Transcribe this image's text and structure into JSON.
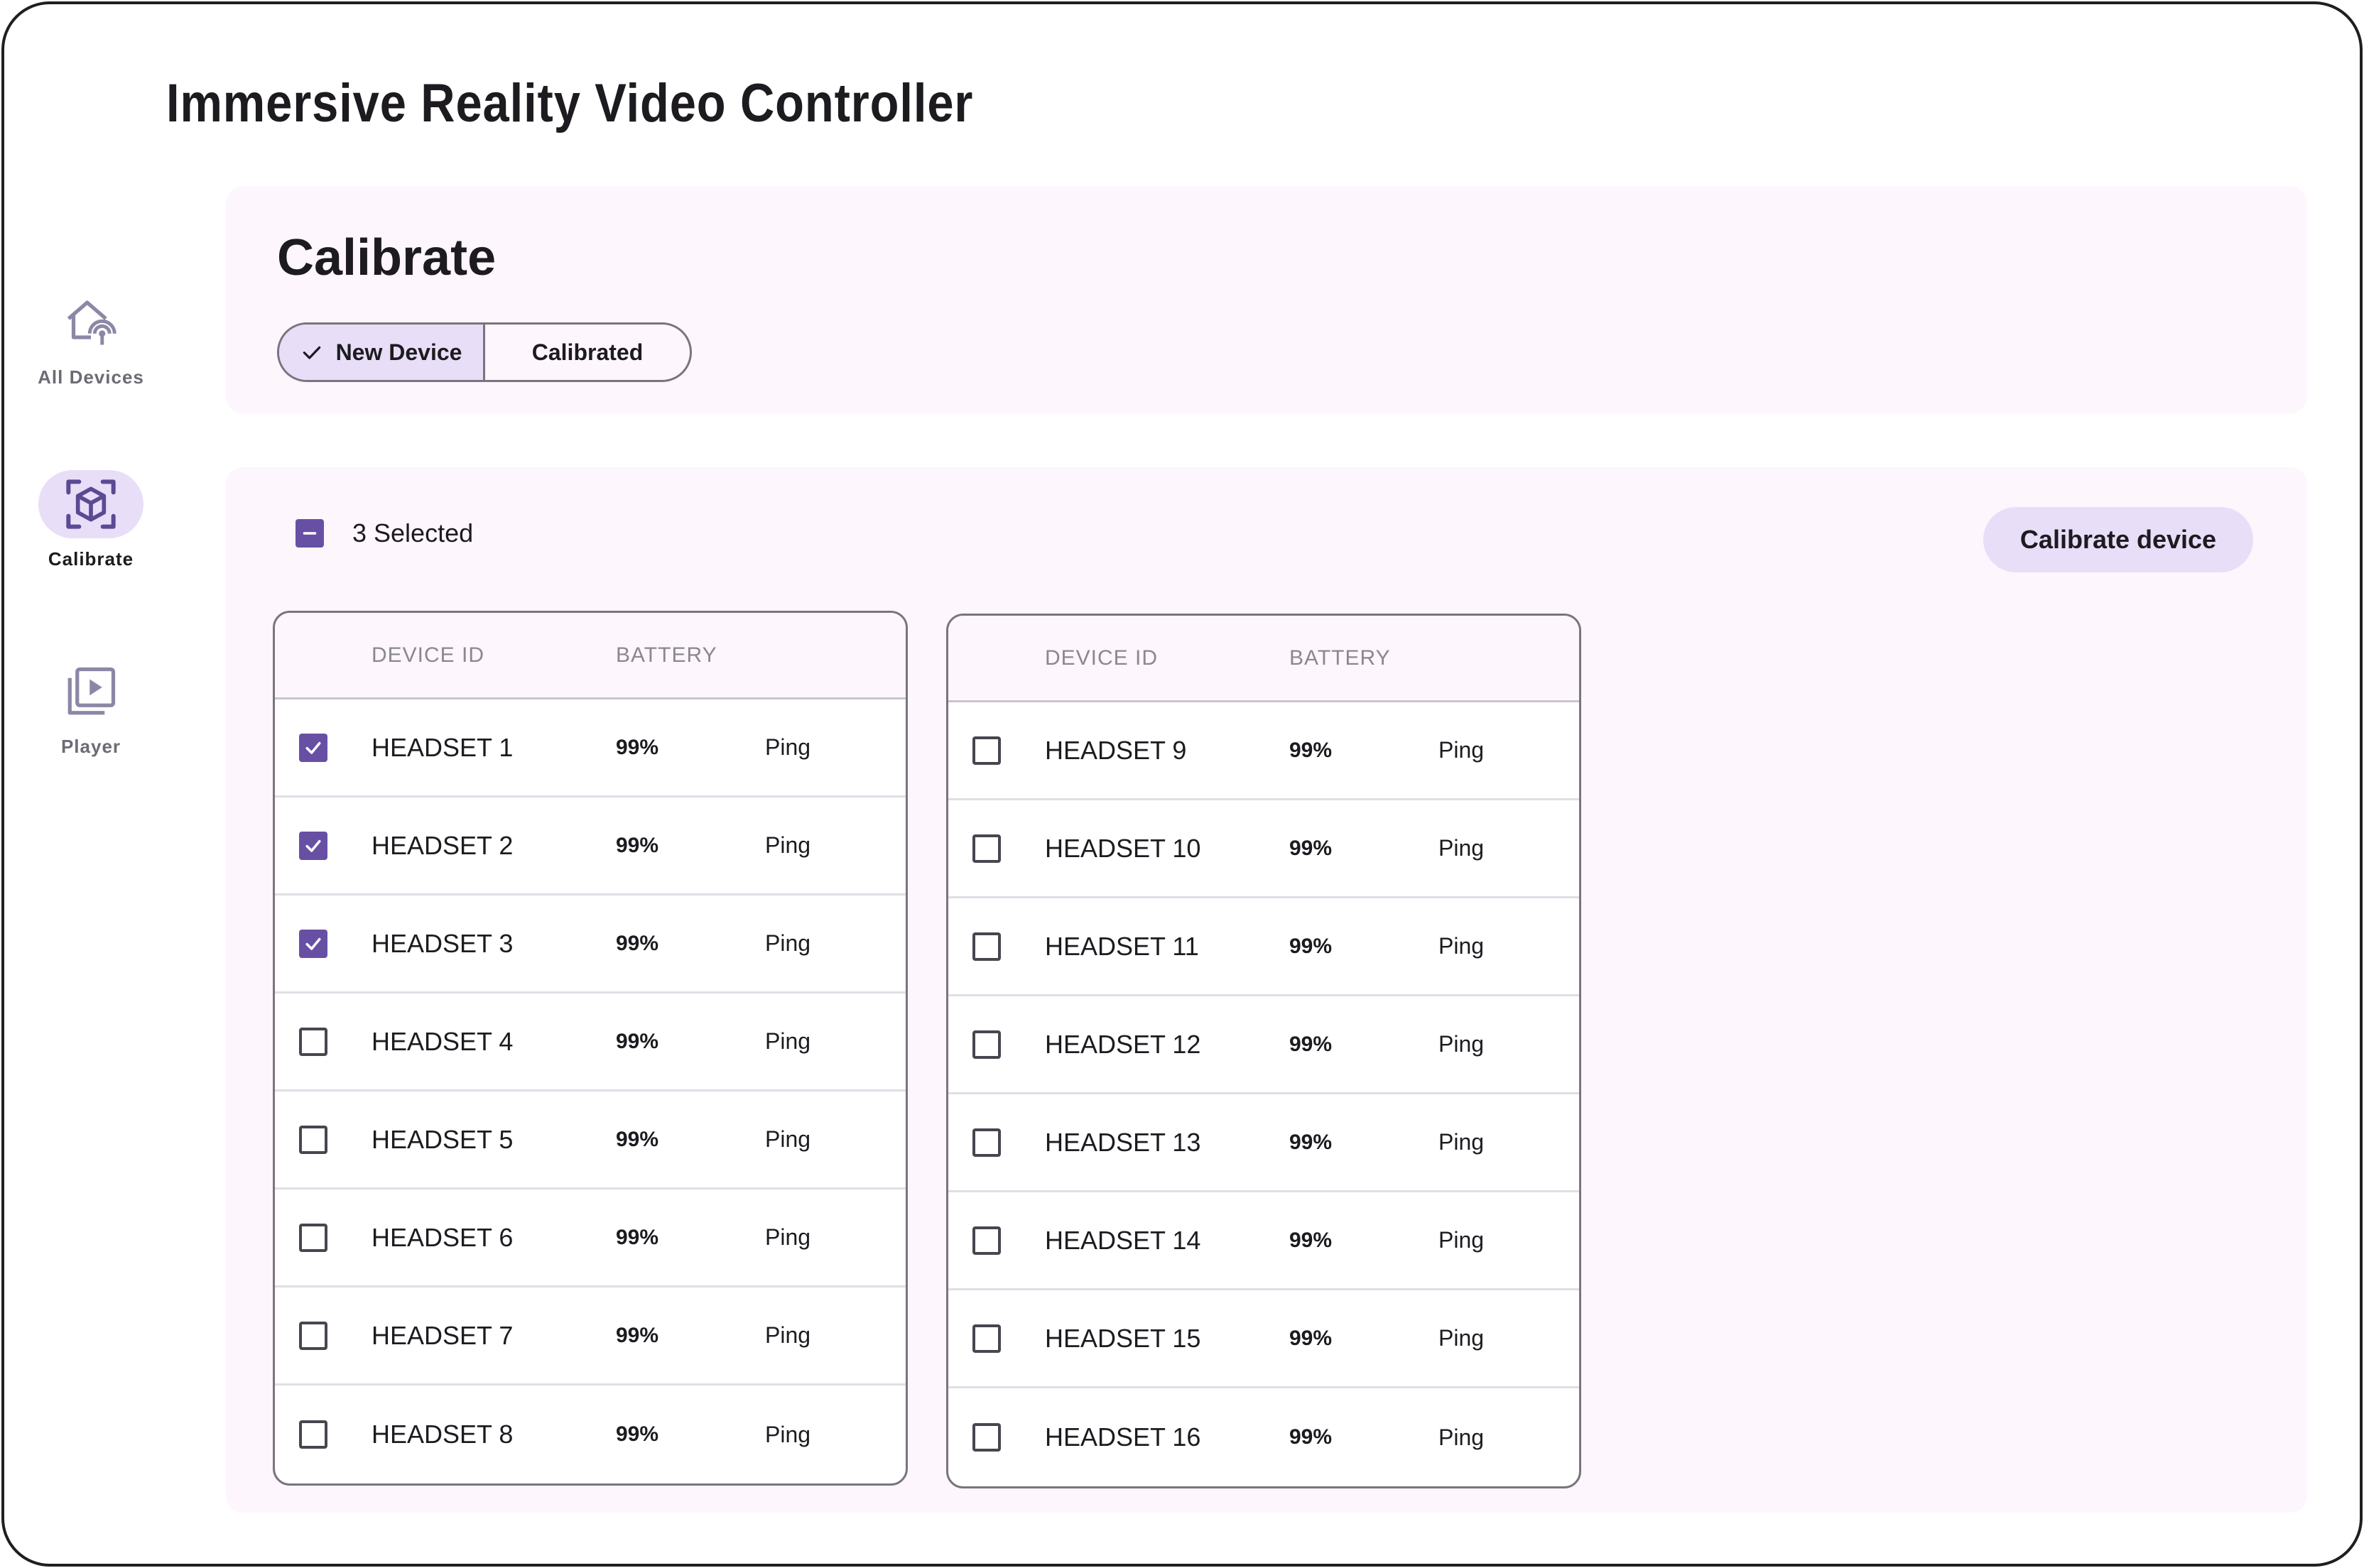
{
  "app": {
    "title": "Immersive Reality Video Controller"
  },
  "nav": {
    "items": [
      {
        "label": "All Devices",
        "icon": "home-signal-icon",
        "active": false
      },
      {
        "label": "Calibrate",
        "icon": "cube-scan-icon",
        "active": true
      },
      {
        "label": "Player",
        "icon": "video-library-icon",
        "active": false
      }
    ]
  },
  "calibrate": {
    "title": "Calibrate",
    "segments": {
      "selected": "New Device",
      "other": "Calibrated"
    }
  },
  "selection": {
    "count_text": "3 Selected",
    "action_label": "Calibrate device"
  },
  "table_headers": {
    "device_id": "DEVICE ID",
    "battery": "BATTERY"
  },
  "tables": [
    [
      {
        "id": "HEADSET 1",
        "battery": "99%",
        "action": "Ping",
        "checked": true
      },
      {
        "id": "HEADSET 2",
        "battery": "99%",
        "action": "Ping",
        "checked": true
      },
      {
        "id": "HEADSET 3",
        "battery": "99%",
        "action": "Ping",
        "checked": true
      },
      {
        "id": "HEADSET 4",
        "battery": "99%",
        "action": "Ping",
        "checked": false
      },
      {
        "id": "HEADSET 5",
        "battery": "99%",
        "action": "Ping",
        "checked": false
      },
      {
        "id": "HEADSET 6",
        "battery": "99%",
        "action": "Ping",
        "checked": false
      },
      {
        "id": "HEADSET 7",
        "battery": "99%",
        "action": "Ping",
        "checked": false
      },
      {
        "id": "HEADSET 8",
        "battery": "99%",
        "action": "Ping",
        "checked": false
      }
    ],
    [
      {
        "id": "HEADSET 9",
        "battery": "99%",
        "action": "Ping",
        "checked": false
      },
      {
        "id": "HEADSET 10",
        "battery": "99%",
        "action": "Ping",
        "checked": false
      },
      {
        "id": "HEADSET 11",
        "battery": "99%",
        "action": "Ping",
        "checked": false
      },
      {
        "id": "HEADSET 12",
        "battery": "99%",
        "action": "Ping",
        "checked": false
      },
      {
        "id": "HEADSET 13",
        "battery": "99%",
        "action": "Ping",
        "checked": false
      },
      {
        "id": "HEADSET 14",
        "battery": "99%",
        "action": "Ping",
        "checked": false
      },
      {
        "id": "HEADSET 15",
        "battery": "99%",
        "action": "Ping",
        "checked": false
      },
      {
        "id": "HEADSET 16",
        "battery": "99%",
        "action": "Ping",
        "checked": false
      }
    ]
  ],
  "colors": {
    "accent": "#6750a4",
    "accent_container": "#e8def8",
    "panel_bg": "#fdf6fc",
    "outline": "#79747e"
  }
}
